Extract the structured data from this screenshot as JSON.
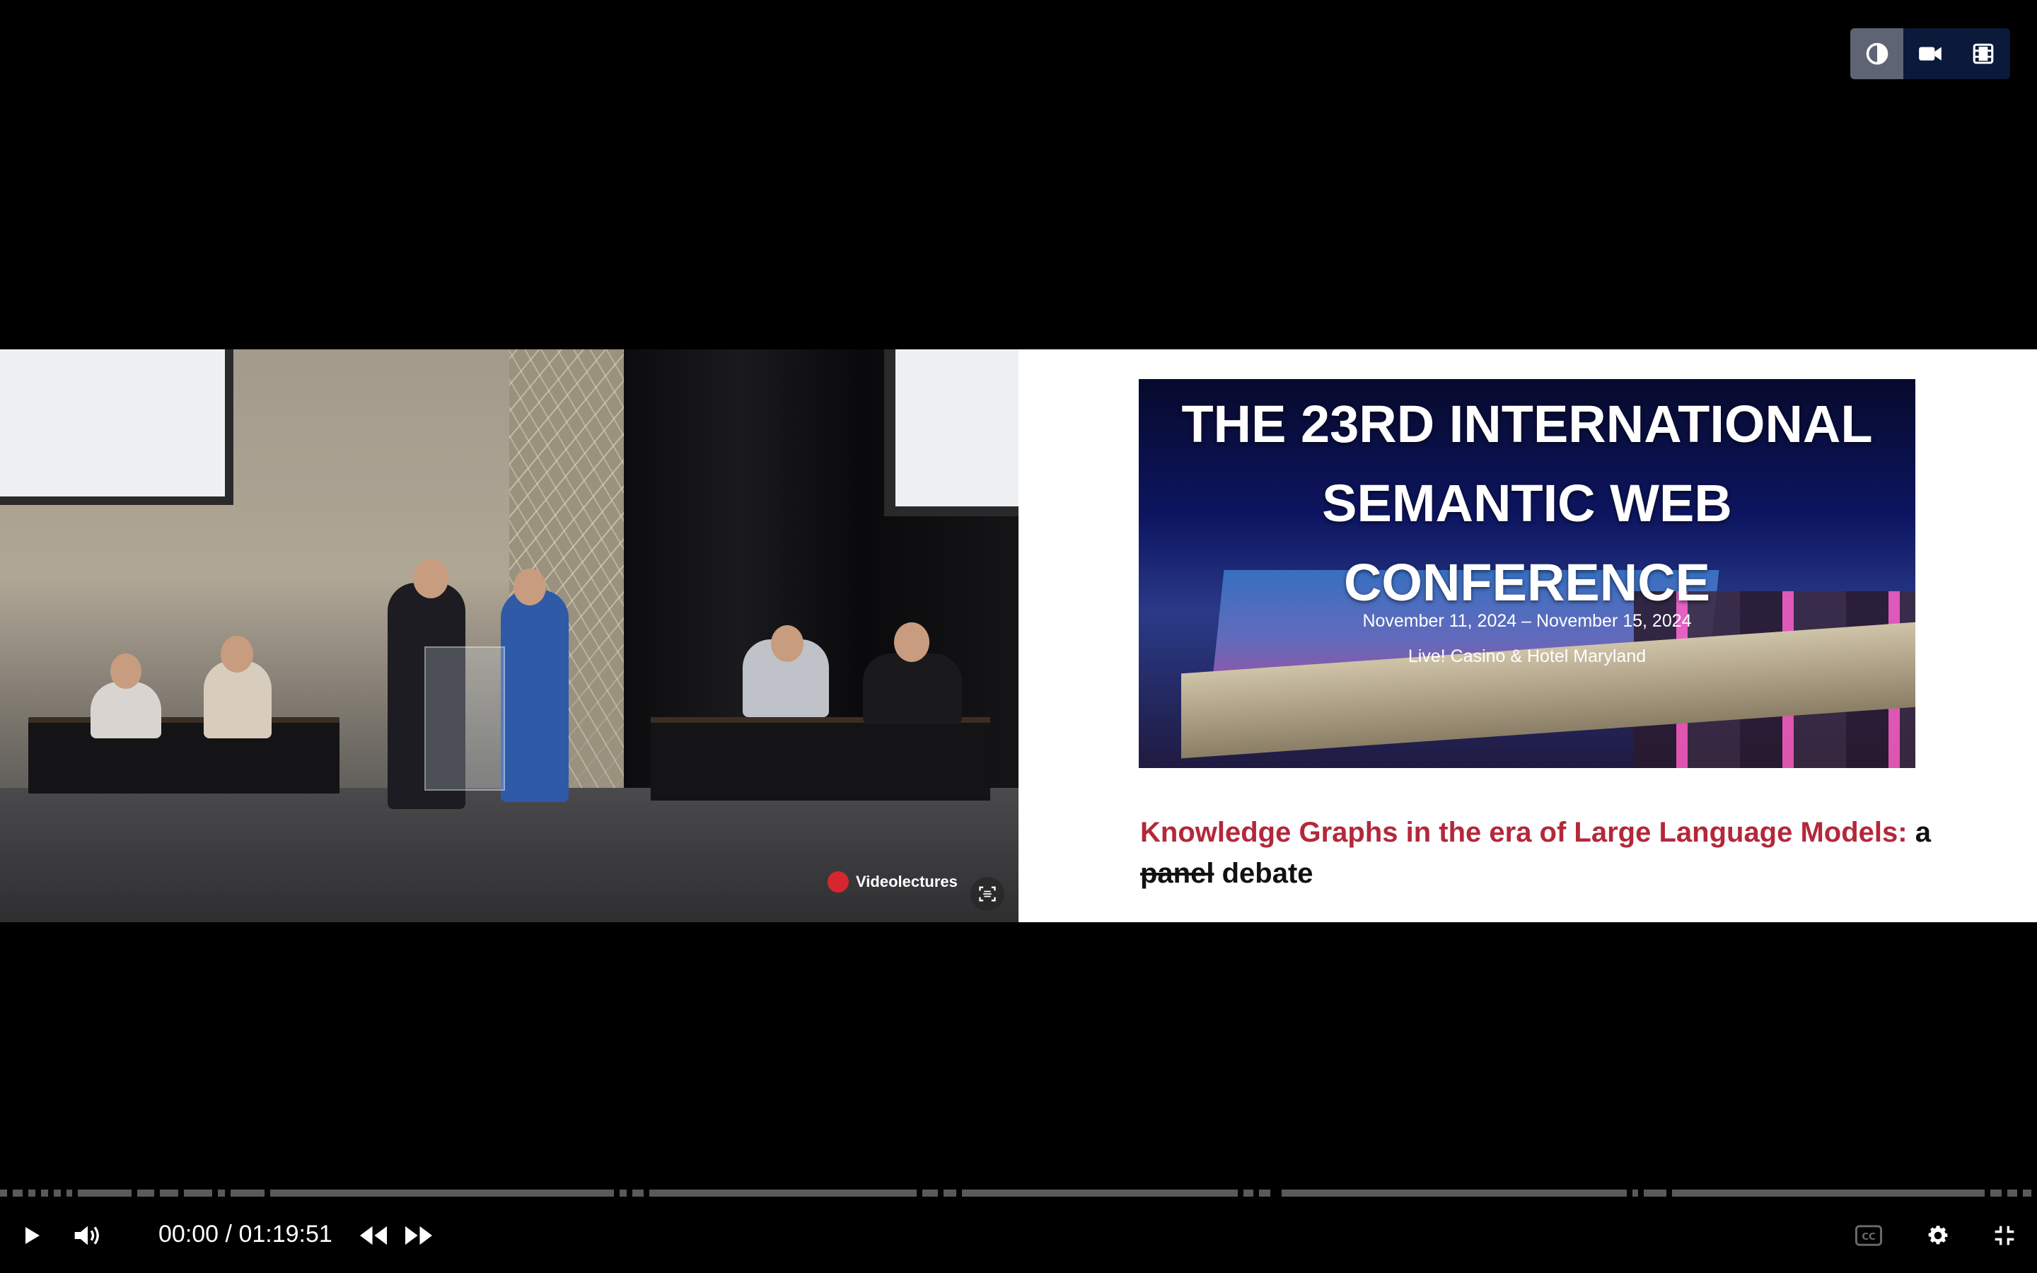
{
  "layout_switcher": {
    "options": [
      {
        "icon": "contrast-icon",
        "active": true
      },
      {
        "icon": "video-camera-icon",
        "active": false
      },
      {
        "icon": "film-icon",
        "active": false
      }
    ]
  },
  "video": {
    "watermark": "Videolectures"
  },
  "slide": {
    "banner_title_line1": "THE 23RD INTERNATIONAL",
    "banner_title_line2": "SEMANTIC WEB",
    "banner_title_line3": "CONFERENCE",
    "dates": "November 11, 2024 – November 15, 2024",
    "venue": "Live! Casino & Hotel Maryland",
    "talk_title_accent": "Knowledge Graphs in the era of Large Language Models:",
    "talk_title_a": "a",
    "talk_title_struck": "panel",
    "talk_title_end": "debate"
  },
  "player": {
    "current_time": "00:00",
    "separator": "/",
    "duration": "01:19:51",
    "progress": 0,
    "icons": [
      "play-icon",
      "volume-icon",
      "rewind-icon",
      "fast-forward-icon",
      "captions-icon",
      "settings-icon",
      "exit-fullscreen-icon"
    ]
  },
  "colors": {
    "accent_red": "#b3283b",
    "switcher_bg": "#0b1a3a",
    "switcher_active": "#5f6474",
    "watermark_red": "#d8262f"
  }
}
